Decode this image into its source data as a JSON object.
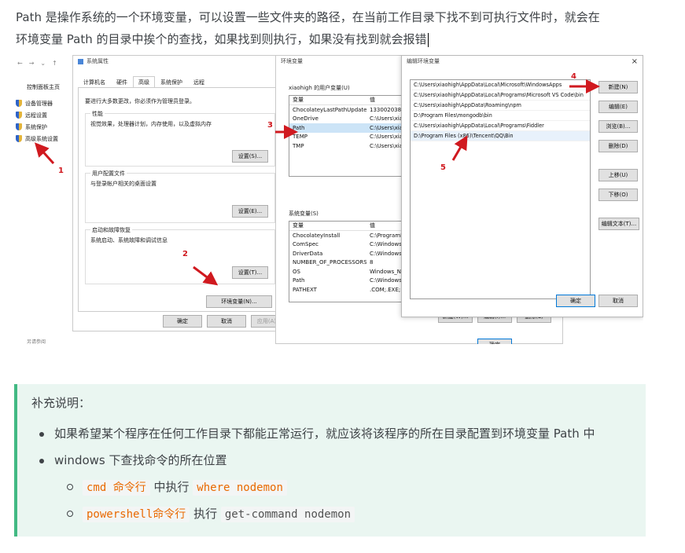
{
  "intro": {
    "line1": "Path 是操作系统的一个环境变量，可以设置一些文件夹的路径，在当前工作目录下找不到可执行文件时，就会在",
    "line2": "环境变量 Path 的目录中挨个的查找，如果找到则执行，如果没有找到就会报错"
  },
  "screenshot": {
    "control_panel": {
      "home": "控制面板主页",
      "items": [
        "设备管理器",
        "远程设置",
        "系统保护",
        "高级系统设置"
      ],
      "bottom": "另请参阅"
    },
    "system_properties": {
      "title": "系统属性",
      "tabs": [
        "计算机名",
        "硬件",
        "高级",
        "系统保护",
        "远程"
      ],
      "admin_note": "要进行大多数更改，你必须作为管理员登录。",
      "performance_label": "性能",
      "performance_desc": "视觉效果，处理器计划，内存使用，以及虚拟内存",
      "settings_button_1": "设置(S)...",
      "profile_label": "用户配置文件",
      "profile_desc": "与登录帐户相关的桌面设置",
      "settings_button_2": "设置(E)...",
      "startup_label": "启动和故障恢复",
      "startup_desc": "系统启动、系统故障和调试信息",
      "settings_button_3": "设置(T)...",
      "env_button": "环境变量(N)...",
      "ok": "确定",
      "cancel": "取消",
      "apply": "应用(A)"
    },
    "env_vars": {
      "title": "环境变量",
      "user_section": "xiaohigh 的用户变量(U)",
      "col_var": "变量",
      "col_val": "值",
      "user_rows": [
        {
          "name": "ChocolateyLastPathUpdate",
          "value": "1330020387"
        },
        {
          "name": "OneDrive",
          "value": "C:\\Users\\xia"
        },
        {
          "name": "Path",
          "value": "C:\\Users\\xia"
        },
        {
          "name": "TEMP",
          "value": "C:\\Users\\xia"
        },
        {
          "name": "TMP",
          "value": "C:\\Users\\xia"
        }
      ],
      "system_section": "系统变量(S)",
      "system_rows": [
        {
          "name": "ChocolateyInstall",
          "value": "C:\\ProgramD"
        },
        {
          "name": "ComSpec",
          "value": "C:\\Windows"
        },
        {
          "name": "DriverData",
          "value": "C:\\Windows"
        },
        {
          "name": "NUMBER_OF_PROCESSORS",
          "value": "8"
        },
        {
          "name": "OS",
          "value": "Windows_NT"
        },
        {
          "name": "Path",
          "value": "C:\\Windows"
        },
        {
          "name": "PATHEXT",
          "value": ".COM;.EXE;.B"
        }
      ],
      "new_button": "新建(W)...",
      "edit_button": "编辑(I)...",
      "delete_button": "删除(L)",
      "ok": "确定"
    },
    "edit_env": {
      "title": "编辑环境变量",
      "close": "×",
      "entries": [
        "C:\\Users\\xiaohigh\\AppData\\Local\\Microsoft\\WindowsApps",
        "C:\\Users\\xiaohigh\\AppData\\Local\\Programs\\Microsoft VS Code\\bin",
        "C:\\Users\\xiaohigh\\AppData\\Roaming\\npm",
        "D:\\Program Files\\mongodb\\bin",
        "C:\\Users\\xiaohigh\\AppData\\Local\\Programs\\Fiddler",
        "D:\\Program Files (x86)\\Tencent\\QQ\\Bin"
      ],
      "buttons": {
        "new": "新建(N)",
        "edit": "编辑(E)",
        "browse": "浏览(B)...",
        "delete": "删除(D)",
        "up": "上移(U)",
        "down": "下移(O)",
        "edit_text": "编辑文本(T)..."
      },
      "ok": "确定",
      "cancel": "取消"
    },
    "markers": [
      "1",
      "2",
      "3",
      "4",
      "5"
    ],
    "accent": "#d0191f"
  },
  "note": {
    "title": "补充说明：",
    "items": [
      {
        "text": "如果希望某个程序在任何工作目录下都能正常运行，就应该将该程序的所在目录配置到环境变量 Path 中"
      },
      {
        "text": "windows 下查找命令的所在位置"
      }
    ],
    "subitems": [
      {
        "code1": "cmd 命令行",
        "mid": "中执行",
        "code2": "where nodemon"
      },
      {
        "code1": "powershell命令行",
        "mid": "执行",
        "code2": "get-command nodemon"
      }
    ],
    "colors": {
      "border": "#42b983",
      "background": "#eaf6f1",
      "code": "#e96900"
    }
  }
}
